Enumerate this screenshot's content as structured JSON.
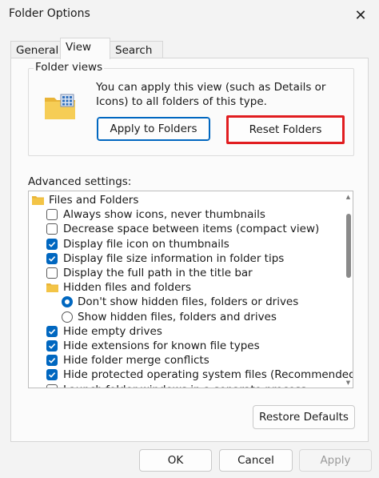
{
  "window": {
    "title": "Folder Options",
    "close_glyph": "✕"
  },
  "tabs": [
    {
      "label": "General",
      "active": false
    },
    {
      "label": "View",
      "active": true
    },
    {
      "label": "Search",
      "active": false
    }
  ],
  "folder_views": {
    "label": "Folder views",
    "description": "You can apply this view (such as Details or Icons) to all folders of this type.",
    "apply_label": "Apply to Folders",
    "reset_label": "Reset Folders",
    "highlight_color": "#e11d20"
  },
  "advanced": {
    "label": "Advanced settings:",
    "items": [
      {
        "kind": "folder",
        "indent": 0,
        "label": "Files and Folders"
      },
      {
        "kind": "checkbox",
        "indent": 1,
        "checked": false,
        "label": "Always show icons, never thumbnails"
      },
      {
        "kind": "checkbox",
        "indent": 1,
        "checked": false,
        "label": "Decrease space between items (compact view)"
      },
      {
        "kind": "checkbox",
        "indent": 1,
        "checked": true,
        "label": "Display file icon on thumbnails"
      },
      {
        "kind": "checkbox",
        "indent": 1,
        "checked": true,
        "label": "Display file size information in folder tips"
      },
      {
        "kind": "checkbox",
        "indent": 1,
        "checked": false,
        "label": "Display the full path in the title bar"
      },
      {
        "kind": "folder",
        "indent": 1,
        "label": "Hidden files and folders"
      },
      {
        "kind": "radio",
        "indent": 2,
        "checked": true,
        "label": "Don't show hidden files, folders or drives"
      },
      {
        "kind": "radio",
        "indent": 2,
        "checked": false,
        "label": "Show hidden files, folders and drives"
      },
      {
        "kind": "checkbox",
        "indent": 1,
        "checked": true,
        "label": "Hide empty drives"
      },
      {
        "kind": "checkbox",
        "indent": 1,
        "checked": true,
        "label": "Hide extensions for known file types"
      },
      {
        "kind": "checkbox",
        "indent": 1,
        "checked": true,
        "label": "Hide folder merge conflicts"
      },
      {
        "kind": "checkbox",
        "indent": 1,
        "checked": true,
        "label": "Hide protected operating system files (Recommended)"
      },
      {
        "kind": "checkbox",
        "indent": 1,
        "checked": false,
        "label": "Launch folder windows in a separate process"
      }
    ]
  },
  "restore_label": "Restore Defaults",
  "footer": {
    "ok": "OK",
    "cancel": "Cancel",
    "apply": "Apply"
  },
  "colors": {
    "accent": "#0067c0",
    "folder": "#f3c446"
  }
}
